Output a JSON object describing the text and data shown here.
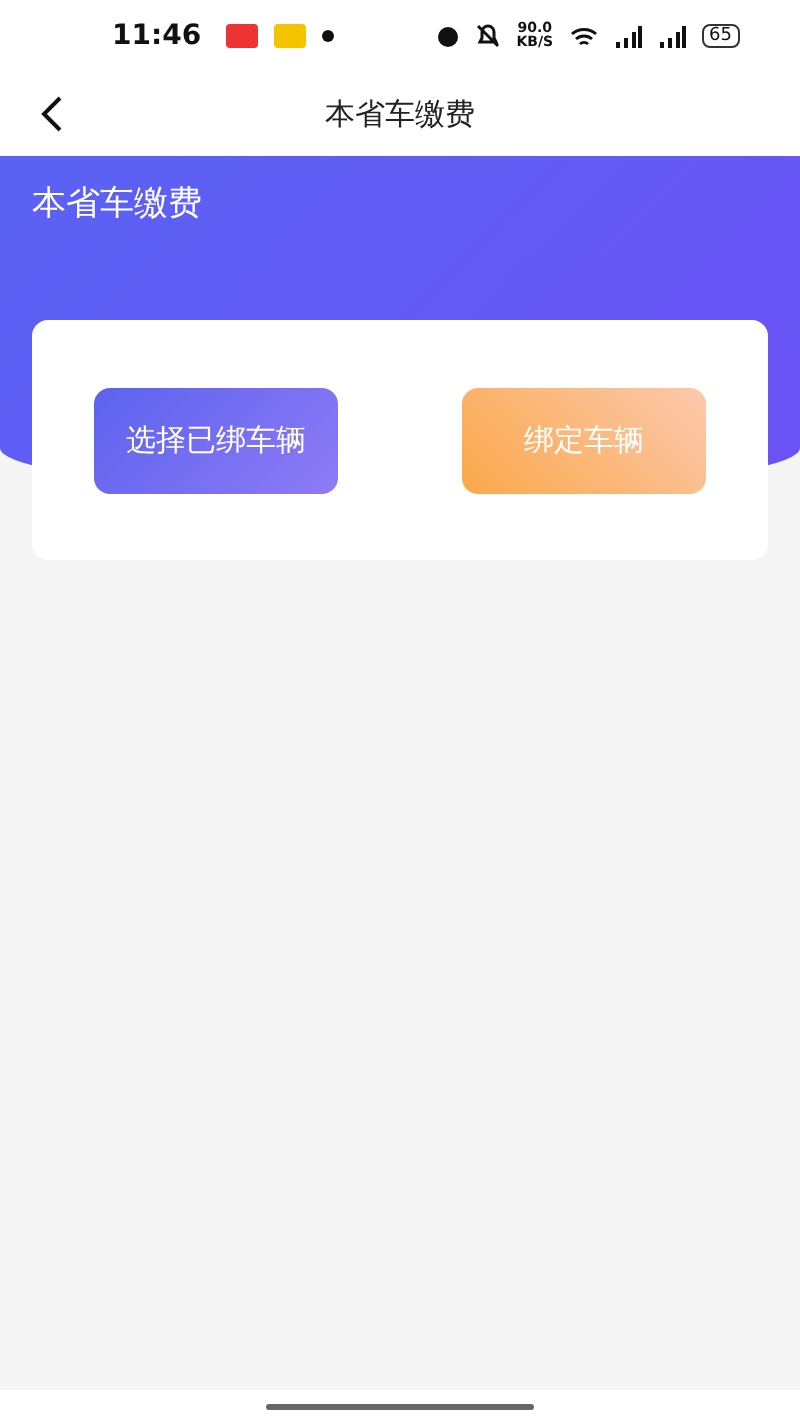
{
  "status_bar": {
    "time": "11:46",
    "speed": "90.0",
    "speed_unit": "KB/S",
    "battery": "65"
  },
  "nav_bar": {
    "title": "本省车缴费"
  },
  "header": {
    "title": "本省车缴费"
  },
  "buttons": [
    {
      "label": "选择已绑车辆",
      "kind": "blue"
    },
    {
      "label": "绑定车辆",
      "kind": "orange"
    }
  ]
}
